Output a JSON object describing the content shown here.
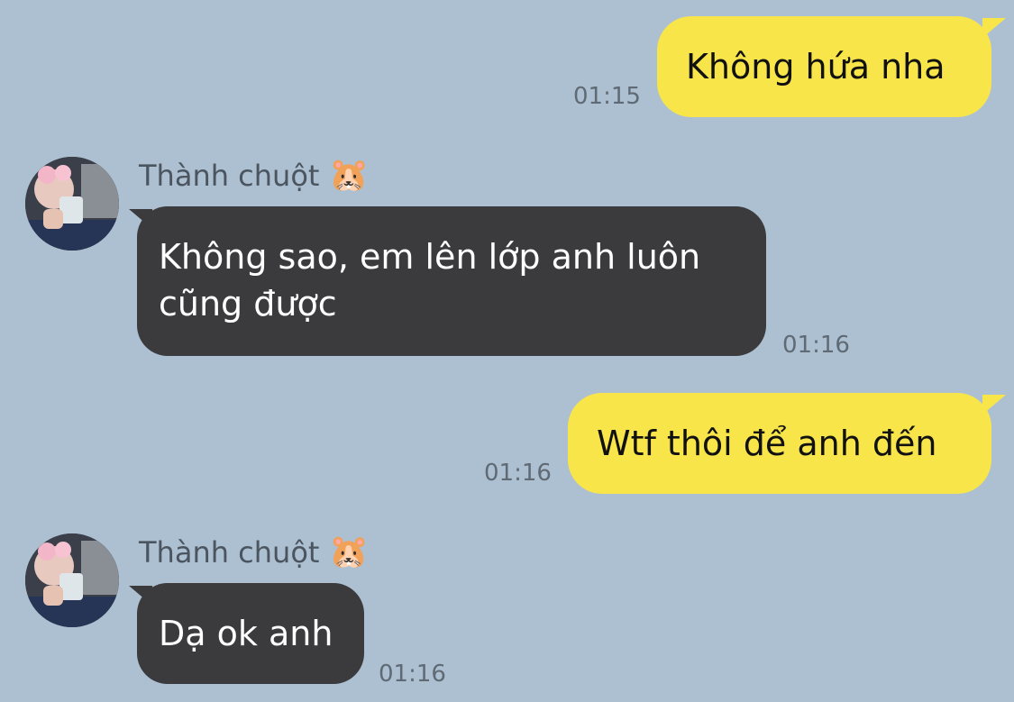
{
  "colors": {
    "background": "#adc0d1",
    "outgoing_bubble": "#f8e54a",
    "incoming_bubble": "#3b3a3d"
  },
  "messages": [
    {
      "direction": "outgoing",
      "text": "Không hứa nha",
      "time": "01:15"
    },
    {
      "direction": "incoming",
      "sender": "Thành chuột",
      "sender_icon": "hamster-emoji",
      "text_line1": "Không sao, em lên lớp anh luôn",
      "text_line2": "cũng được",
      "time": "01:16"
    },
    {
      "direction": "outgoing",
      "text": "Wtf thôi để anh đến",
      "time": "01:16"
    },
    {
      "direction": "incoming",
      "sender": "Thành chuột",
      "sender_icon": "hamster-emoji",
      "text": "Dạ ok anh",
      "time": "01:16"
    }
  ]
}
